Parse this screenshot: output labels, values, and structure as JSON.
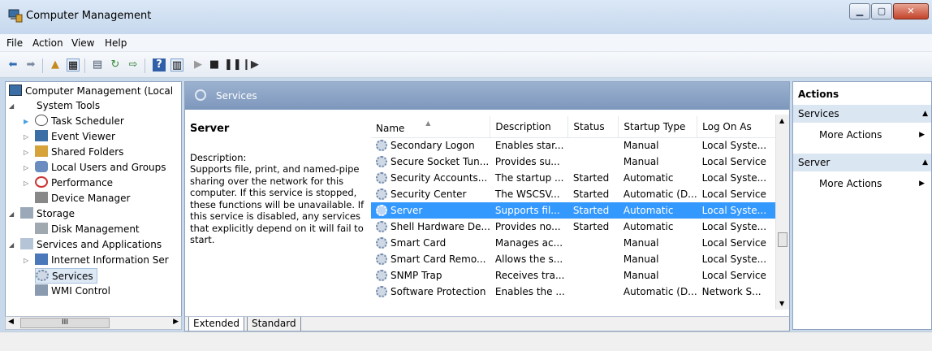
{
  "window": {
    "title": "Computer Management"
  },
  "menu": [
    "File",
    "Action",
    "View",
    "Help"
  ],
  "tree": {
    "items": [
      {
        "label": "Computer Management (Local"
      },
      {
        "label": "System Tools"
      },
      {
        "label": "Task Scheduler"
      },
      {
        "label": "Event Viewer"
      },
      {
        "label": "Shared Folders"
      },
      {
        "label": "Local Users and Groups"
      },
      {
        "label": "Performance"
      },
      {
        "label": "Device Manager"
      },
      {
        "label": "Storage"
      },
      {
        "label": "Disk Management"
      },
      {
        "label": "Services and Applications"
      },
      {
        "label": "Internet Information Ser"
      },
      {
        "label": "Services"
      },
      {
        "label": "WMI Control"
      }
    ],
    "scroll_thumb": "III"
  },
  "main": {
    "header": "Services",
    "selected_service": "Server",
    "description_label": "Description:",
    "description_text": "Supports file, print, and named-pipe sharing over the network for this computer. If this service is stopped, these functions will be unavailable. If this service is disabled, any services that explicitly depend on it will fail to start.",
    "columns": [
      "Name",
      "Description",
      "Status",
      "Startup Type",
      "Log On As"
    ],
    "rows": [
      [
        "Secondary Logon",
        "Enables star...",
        "",
        "Manual",
        "Local Syste..."
      ],
      [
        "Secure Socket Tun...",
        "Provides su...",
        "",
        "Manual",
        "Local Service"
      ],
      [
        "Security Accounts...",
        "The startup ...",
        "Started",
        "Automatic",
        "Local Syste..."
      ],
      [
        "Security Center",
        "The WSCSV...",
        "Started",
        "Automatic (D...",
        "Local Service"
      ],
      [
        "Server",
        "Supports fil...",
        "Started",
        "Automatic",
        "Local Syste..."
      ],
      [
        "Shell Hardware De...",
        "Provides no...",
        "Started",
        "Automatic",
        "Local Syste..."
      ],
      [
        "Smart Card",
        "Manages ac...",
        "",
        "Manual",
        "Local Service"
      ],
      [
        "Smart Card Remo...",
        "Allows the s...",
        "",
        "Manual",
        "Local Syste..."
      ],
      [
        "SNMP Trap",
        "Receives tra...",
        "",
        "Manual",
        "Local Service"
      ],
      [
        "Software Protection",
        "Enables the ...",
        "",
        "Automatic (D...",
        "Network S..."
      ]
    ],
    "selected_row": 4,
    "tabs": [
      "Extended",
      "Standard"
    ]
  },
  "actions": {
    "title": "Actions",
    "sections": [
      {
        "header": "Services",
        "item": "More Actions"
      },
      {
        "header": "Server",
        "item": "More Actions"
      }
    ]
  },
  "colors": {
    "selection": "#3399ff",
    "pane_header": "#8fa7c8",
    "accent_header": "#dbe6f3"
  }
}
